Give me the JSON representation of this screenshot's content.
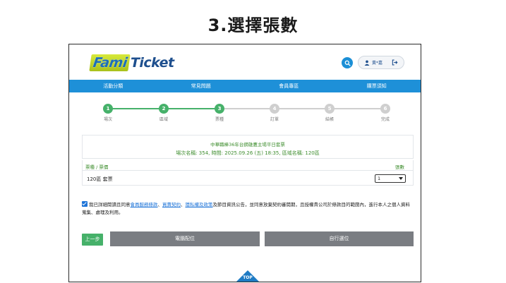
{
  "heading": "3.選擇張數",
  "logo": {
    "part1": "Fami",
    "part2": "Ticket"
  },
  "colors": {
    "accent": "#1e90d8",
    "done": "#46b16a",
    "pending": "#cfcfcf",
    "info_text": "#3f8e2f",
    "button_gray": "#7a7d82"
  },
  "header": {
    "search_icon": "search-icon",
    "user_name": "黃*嘉",
    "logout_icon": "logout-icon"
  },
  "nav": [
    {
      "label": "活動分類"
    },
    {
      "label": "常見問題"
    },
    {
      "label": "會員專區"
    },
    {
      "label": "購票須知"
    }
  ],
  "steps": [
    {
      "num": "1",
      "label": "場次",
      "done": true
    },
    {
      "num": "2",
      "label": "區域",
      "done": true
    },
    {
      "num": "3",
      "label": "票種",
      "done": true
    },
    {
      "num": "4",
      "label": "訂單",
      "done": false
    },
    {
      "num": "5",
      "label": "結帳",
      "done": false
    },
    {
      "num": "6",
      "label": "完成",
      "done": false
    }
  ],
  "event": {
    "title": "中華職棒36年台鋼雄鷹主場平日套票",
    "detail": "場次名稱: 354, 時間: 2025.09.26 (五) 18:35, 區域名稱: 120區"
  },
  "table": {
    "col_type": "票種 / 票價",
    "col_qty": "張數",
    "rows": [
      {
        "name": "120區 套票",
        "qty": "1"
      }
    ]
  },
  "agreement": {
    "pre": "我已詳細閱讀且同意",
    "link1": "會員服務條款",
    "sep1": "、",
    "link2": "買賣契約",
    "sep2": "、",
    "link3": "隱私權及政策",
    "post": "及節目資訊公告，並同意放棄契約審閱期，且授權貴公司於條款目的範圍內，進行本人之個人資料蒐集、處理及利用。",
    "checked": true
  },
  "buttons": {
    "prev": "上一步",
    "auto": "電腦配位",
    "manual": "自行選位"
  },
  "top_label": "TOP"
}
